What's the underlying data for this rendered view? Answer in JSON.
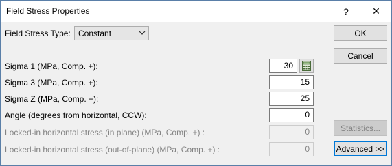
{
  "window": {
    "title": "Field Stress Properties",
    "help": "?",
    "close": "✕"
  },
  "type_row": {
    "label": "Field Stress Type:",
    "value": "Constant"
  },
  "fields": [
    {
      "label": "Sigma 1 (MPa, Comp. +):",
      "value": "30"
    },
    {
      "label": "Sigma 3 (MPa, Comp. +):",
      "value": "15"
    },
    {
      "label": "Sigma Z (MPa, Comp. +):",
      "value": "25"
    },
    {
      "label": "Angle (degrees from horizontal, CCW):",
      "value": "0"
    },
    {
      "label": "Locked-in horizontal stress (in plane) (MPa, Comp. +) :",
      "value": "0"
    },
    {
      "label": "Locked-in horizontal stress (out-of-plane) (MPa, Comp. +) :",
      "value": "0"
    }
  ],
  "buttons": {
    "ok": "OK",
    "cancel": "Cancel",
    "statistics": "Statistics...",
    "advanced": "Advanced >>"
  }
}
